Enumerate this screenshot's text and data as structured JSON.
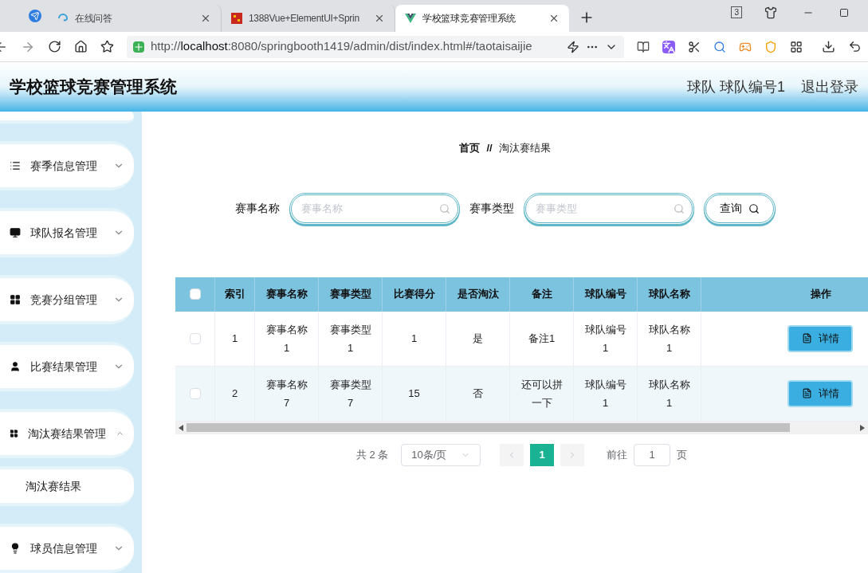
{
  "browser": {
    "tabs": [
      {
        "title": "在线问答",
        "selected": false
      },
      {
        "title": "1388Vue+ElementUI+Sprin",
        "selected": false
      },
      {
        "title": "学校篮球竞赛管理系统",
        "selected": true
      }
    ],
    "tab_count": "3",
    "address": {
      "scheme": "http://",
      "host": "localhost",
      "rest": ":8080/springbooth1419/admin/dist/index.html#/taotaisaijie"
    }
  },
  "header": {
    "title": "学校篮球竞赛管理系统",
    "user": "球队 球队编号1",
    "logout": "退出登录"
  },
  "sidebar": {
    "items": [
      {
        "label": "赛季信息管理",
        "expanded": false
      },
      {
        "label": "球队报名管理",
        "expanded": false
      },
      {
        "label": "竞赛分组管理",
        "expanded": false
      },
      {
        "label": "比赛结果管理",
        "expanded": false
      },
      {
        "label": "淘汰赛结果管理",
        "expanded": true,
        "children": [
          {
            "label": "淘汰赛结果"
          }
        ]
      },
      {
        "label": "球员信息管理",
        "expanded": false
      }
    ]
  },
  "breadcrumb": {
    "home": "首页",
    "separator": "//",
    "current": "淘汰赛结果"
  },
  "search": {
    "fields": [
      {
        "label": "赛事名称",
        "placeholder": "赛事名称"
      },
      {
        "label": "赛事类型",
        "placeholder": "赛事类型"
      }
    ],
    "button": "查询"
  },
  "table": {
    "all_checked": false,
    "columns": [
      "索引",
      "赛事名称",
      "赛事类型",
      "比赛得分",
      "是否淘汰",
      "备注",
      "球队编号",
      "球队名称",
      "操作"
    ],
    "rows": [
      {
        "checked": false,
        "cells": [
          "1",
          "赛事名称1",
          "赛事类型1",
          "1",
          "是",
          "备注1",
          "球队编号1",
          "球队名称1"
        ],
        "action": "详情"
      },
      {
        "checked": false,
        "cells": [
          "2",
          "赛事名称7",
          "赛事类型7",
          "15",
          "否",
          "还可以拼一下",
          "球队编号1",
          "球队名称1"
        ],
        "action": "详情"
      }
    ]
  },
  "pagination": {
    "total": "共 2 条",
    "page_size": "10条/页",
    "pages": [
      {
        "label": "1",
        "selected": true
      }
    ],
    "goto": "前往",
    "goto_value": "1",
    "page_unit": "页"
  }
}
